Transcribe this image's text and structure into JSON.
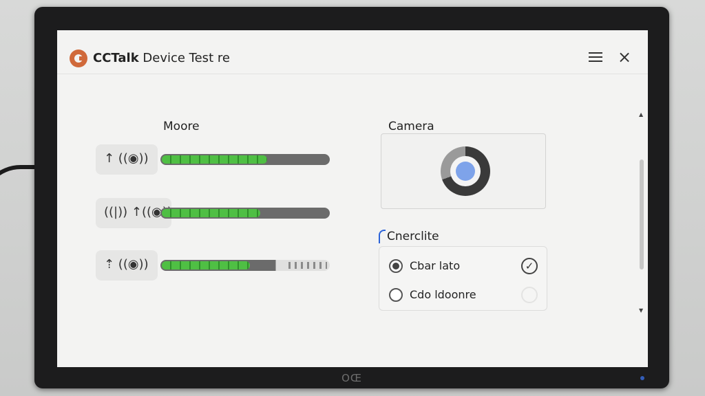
{
  "app": {
    "title_bold": "CCTalk",
    "title_rest": " Device Test re"
  },
  "microphone": {
    "label": "Moore",
    "rows": [
      {
        "icons": "↑  ((◉))",
        "level": 0.62
      },
      {
        "icons": "((|)) ↑((◉))",
        "level": 0.58
      },
      {
        "icons": "⇡  ((◉))",
        "level": 0.52
      }
    ]
  },
  "camera": {
    "label": "Camera"
  },
  "options": {
    "label": "Cnerclite",
    "items": [
      {
        "label": "Cbar lato",
        "selected": true,
        "checked": true,
        "check_glyph": "✓"
      },
      {
        "label": "Cdo ldoonre",
        "selected": false,
        "checked": false,
        "check_glyph": ""
      }
    ]
  },
  "monitor": {
    "brand": "OŒ"
  },
  "scrollbar": {
    "up": "▲",
    "down": "▼"
  },
  "colors": {
    "meter_fill": "#4fbf44",
    "accent": "#2b63d9",
    "logo": "#d0693a",
    "camera_lens": "#7ea3ea"
  }
}
